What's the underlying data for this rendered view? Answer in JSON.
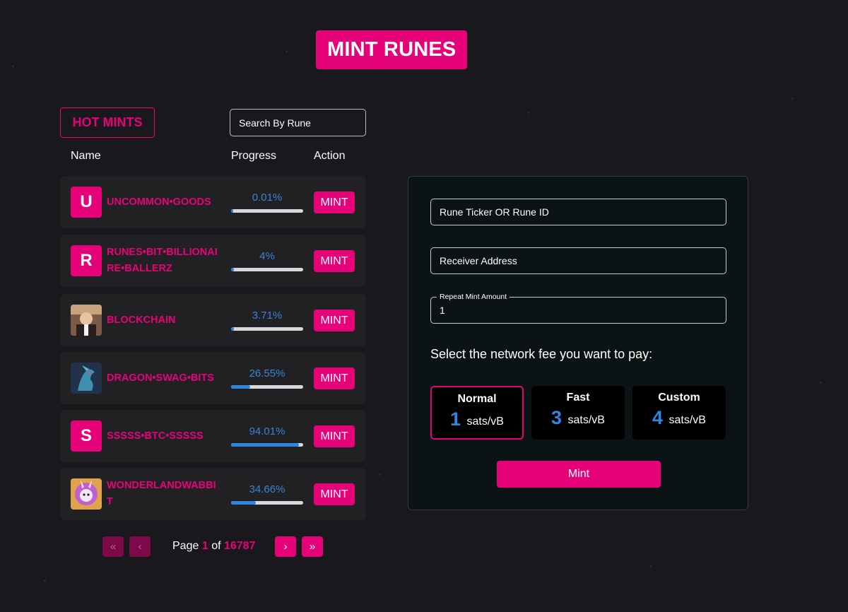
{
  "header": {
    "title": "MINT RUNES"
  },
  "hot_mints": {
    "label": "HOT MINTS",
    "search_placeholder": "Search By Rune",
    "columns": {
      "name": "Name",
      "progress": "Progress",
      "action": "Action"
    },
    "rows": [
      {
        "avatar": "U",
        "name": "UNCOMMON•GOODS",
        "progress_text": "0.01%",
        "progress": 0.01,
        "action": "MINT"
      },
      {
        "avatar": "R",
        "name": "RUNES•BIT•BILLIONAIRE•BALLERZ",
        "progress_text": "4%",
        "progress": 4,
        "action": "MINT"
      },
      {
        "avatar": "",
        "name": "BLOCKCHAIN",
        "progress_text": "3.71%",
        "progress": 3.71,
        "action": "MINT"
      },
      {
        "avatar": "",
        "name": "DRAGON•SWAG•BITS",
        "progress_text": "26.55%",
        "progress": 26.55,
        "action": "MINT"
      },
      {
        "avatar": "S",
        "name": "SSSSS•BTC•SSSSS",
        "progress_text": "94.01%",
        "progress": 94.01,
        "action": "MINT"
      },
      {
        "avatar": "",
        "name": "WONDERLANDWABBIT",
        "progress_text": "34.66%",
        "progress": 34.66,
        "action": "MINT"
      }
    ]
  },
  "pagination": {
    "first": "«",
    "prev": "‹",
    "next": "›",
    "last": "»",
    "page_word": "Page",
    "of_word": "of",
    "current": "1",
    "total": "16787"
  },
  "mint_form": {
    "ticker_placeholder": "Rune Ticker OR Rune ID",
    "receiver_placeholder": "Receiver Address",
    "repeat_label": "Repeat Mint Amount",
    "repeat_value": "1",
    "fee_prompt": "Select the network fee you want to pay:",
    "fees": [
      {
        "label": "Normal",
        "value": "1",
        "unit": "sats/vB",
        "selected": true
      },
      {
        "label": "Fast",
        "value": "3",
        "unit": "sats/vB",
        "selected": false
      },
      {
        "label": "Custom",
        "value": "4",
        "unit": "sats/vB",
        "selected": false
      }
    ],
    "submit_label": "Mint"
  },
  "colors": {
    "accent": "#e6037a",
    "progress": "#2e86de",
    "background": "#18181d",
    "panel": "#0b1314"
  }
}
